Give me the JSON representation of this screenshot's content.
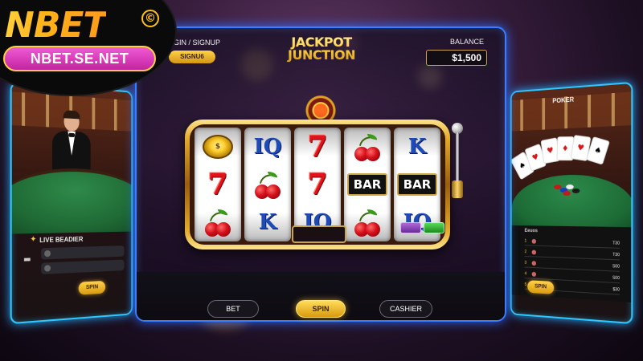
{
  "logo": {
    "brand": "NBET",
    "copyright_mark": "©",
    "url": "NBET.SE.NET"
  },
  "header": {
    "login_text": "GIN / SIGNUP",
    "signup_button": "SIGNU6",
    "game_title_line1": "JACKPOT",
    "game_title_line2": "JUNCTION",
    "balance_label": "BALANCE",
    "balance_value": "$1,500"
  },
  "slot": {
    "reels": [
      [
        "coin",
        "IQ",
        "7"
      ],
      [
        "IQ",
        "cherry",
        "IQ"
      ],
      [
        "7",
        "7",
        "IQ"
      ],
      [
        "cherry",
        "BAR",
        "cherry"
      ],
      [
        "K",
        "BAR",
        "IQ"
      ]
    ],
    "reel_labels": {
      "r0c0": "",
      "r1c0": "7",
      "r2c0": "cherry",
      "r0c1": "IQ",
      "r1c1": "cherry",
      "r2c1": "K",
      "r0c2": "7",
      "r1c2": "7",
      "r2c2": "IQ",
      "r0c3": "cherry",
      "r1c3": "BAR",
      "r2c3": "cherry",
      "r0c4": "K",
      "r1c4": "BAR",
      "r2c4": "IQ"
    }
  },
  "controls": {
    "bet_label": "BET",
    "spin_label": "SPIN",
    "cashier_label": "CASHIER"
  },
  "left_panel": {
    "title": "LIVE BEADIER",
    "spin_label": "SPIN"
  },
  "right_panel": {
    "title": "POKER",
    "spin_label": "SPIN",
    "leaderboard_title": "Eeuos",
    "leaderboard_values": [
      "T30",
      "T30",
      "S00",
      "S00",
      "$30"
    ]
  },
  "colors": {
    "accent_gold": "#ffcd3a",
    "panel_border_blue": "#3a7dff",
    "side_border_cyan": "#2fc8ff",
    "url_pill_pink": "#e04bc4"
  }
}
